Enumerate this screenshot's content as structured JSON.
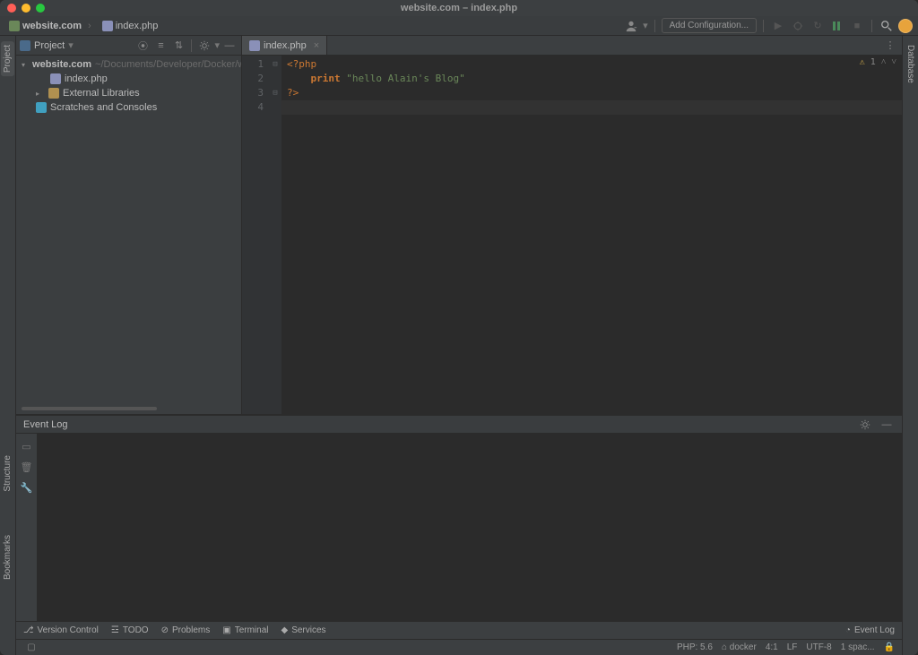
{
  "traffic_colors": {
    "close": "#ff5f57",
    "min": "#febc2e",
    "max": "#28c840"
  },
  "window_title": "website.com – index.php",
  "breadcrumbs": {
    "project": "website.com",
    "file": "index.php"
  },
  "toolbar": {
    "add_config": "Add Configuration...",
    "search_icon": "search",
    "user_icon": "user"
  },
  "left_gutter": {
    "project": "Project",
    "structure": "Structure",
    "bookmarks": "Bookmarks"
  },
  "right_gutter": {
    "database": "Database"
  },
  "project_panel": {
    "title": "Project",
    "root": {
      "name": "website.com",
      "path": "~/Documents/Developer/Docker/ww"
    },
    "file": "index.php",
    "external": "External Libraries",
    "scratches": "Scratches and Consoles"
  },
  "editor": {
    "tab_label": "index.php",
    "warning_count": "1",
    "lines": [
      {
        "n": 1,
        "seg": [
          {
            "t": "<?",
            "c": "tag"
          },
          {
            "t": "php",
            "c": "tag"
          }
        ]
      },
      {
        "n": 2,
        "seg": [
          {
            "t": "    ",
            "c": ""
          },
          {
            "t": "print",
            "c": "kw"
          },
          {
            "t": " ",
            "c": ""
          },
          {
            "t": "\"hello Alain's Blog\"",
            "c": "str"
          }
        ]
      },
      {
        "n": 3,
        "seg": [
          {
            "t": "?>",
            "c": "tag"
          }
        ]
      },
      {
        "n": 4,
        "seg": []
      }
    ]
  },
  "event_log": {
    "title": "Event Log"
  },
  "tool_windows": {
    "version_control": "Version Control",
    "todo": "TODO",
    "problems": "Problems",
    "terminal": "Terminal",
    "services": "Services",
    "event_log": "Event Log"
  },
  "status": {
    "php": "PHP: 5.6",
    "docker": "docker",
    "caret": "4:1",
    "line_sep": "LF",
    "encoding": "UTF-8",
    "indent": "1 spac..."
  }
}
